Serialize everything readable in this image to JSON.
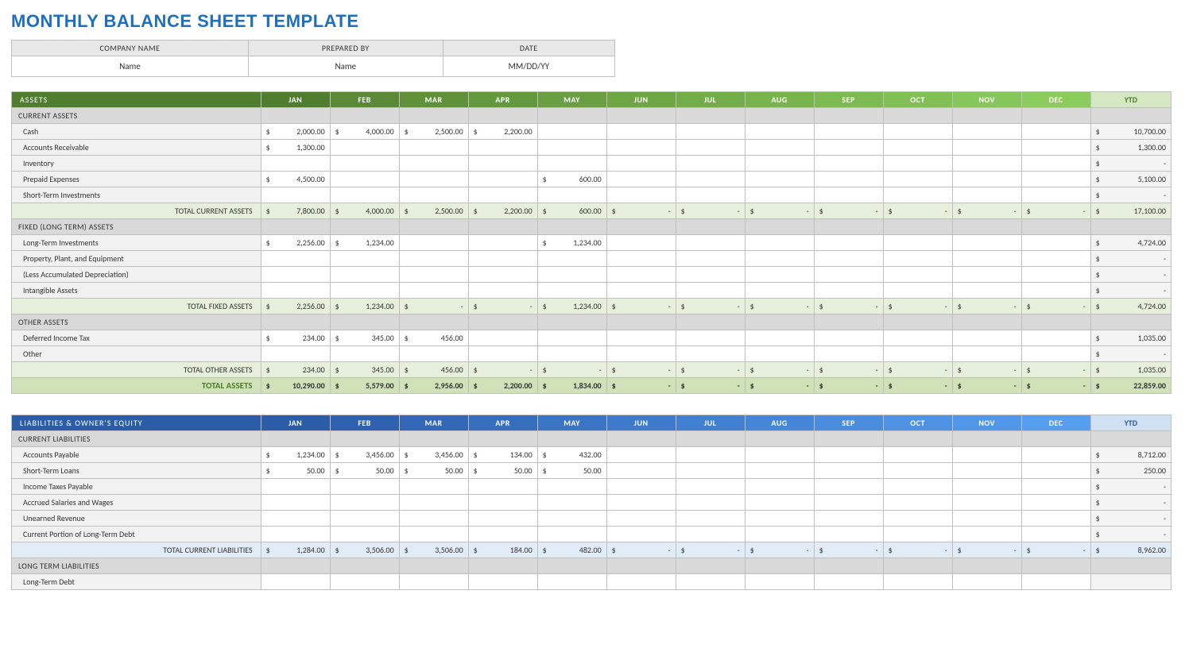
{
  "title": "MONTHLY BALANCE SHEET TEMPLATE",
  "info_headers": [
    "COMPANY NAME",
    "PREPARED BY",
    "DATE"
  ],
  "info_values": [
    "Name",
    "Name",
    "MM/DD/YY"
  ],
  "months": [
    "JAN",
    "FEB",
    "MAR",
    "APR",
    "MAY",
    "JUN",
    "JUL",
    "AUG",
    "SEP",
    "OCT",
    "NOV",
    "DEC"
  ],
  "ytd_label": "YTD",
  "sections": [
    {
      "id": "assets",
      "title": "ASSETS",
      "palette": "g",
      "groups": [
        {
          "header": "CURRENT ASSETS",
          "rows": [
            {
              "label": "Cash",
              "vals": [
                "2,000.00",
                "4,000.00",
                "2,500.00",
                "2,200.00",
                "",
                "",
                "",
                "",
                "",
                "",
                "",
                ""
              ],
              "ytd": "10,700.00"
            },
            {
              "label": "Accounts Receivable",
              "vals": [
                "1,300.00",
                "",
                "",
                "",
                "",
                "",
                "",
                "",
                "",
                "",
                "",
                ""
              ],
              "ytd": "1,300.00"
            },
            {
              "label": "Inventory",
              "vals": [
                "",
                "",
                "",
                "",
                "",
                "",
                "",
                "",
                "",
                "",
                "",
                ""
              ],
              "ytd": "-"
            },
            {
              "label": "Prepaid Expenses",
              "vals": [
                "4,500.00",
                "",
                "",
                "",
                "600.00",
                "",
                "",
                "",
                "",
                "",
                "",
                ""
              ],
              "ytd": "5,100.00"
            },
            {
              "label": "Short-Term Investments",
              "vals": [
                "",
                "",
                "",
                "",
                "",
                "",
                "",
                "",
                "",
                "",
                "",
                ""
              ],
              "ytd": "-"
            }
          ],
          "subtotal": {
            "label": "TOTAL CURRENT ASSETS",
            "vals": [
              "7,800.00",
              "4,000.00",
              "2,500.00",
              "2,200.00",
              "600.00",
              "-",
              "-",
              "-",
              "-",
              "-",
              "-",
              "-"
            ],
            "ytd": "17,100.00"
          }
        },
        {
          "header": "FIXED (LONG TERM) ASSETS",
          "rows": [
            {
              "label": "Long-Term Investments",
              "vals": [
                "2,256.00",
                "1,234.00",
                "",
                "",
                "1,234.00",
                "",
                "",
                "",
                "",
                "",
                "",
                ""
              ],
              "ytd": "4,724.00"
            },
            {
              "label": "Property, Plant, and Equipment",
              "vals": [
                "",
                "",
                "",
                "",
                "",
                "",
                "",
                "",
                "",
                "",
                "",
                ""
              ],
              "ytd": "-"
            },
            {
              "label": "(Less Accumulated Depreciation)",
              "vals": [
                "",
                "",
                "",
                "",
                "",
                "",
                "",
                "",
                "",
                "",
                "",
                ""
              ],
              "ytd": "-"
            },
            {
              "label": "Intangible Assets",
              "vals": [
                "",
                "",
                "",
                "",
                "",
                "",
                "",
                "",
                "",
                "",
                "",
                ""
              ],
              "ytd": "-"
            }
          ],
          "subtotal": {
            "label": "TOTAL FIXED ASSETS",
            "vals": [
              "2,256.00",
              "1,234.00",
              "-",
              "-",
              "1,234.00",
              "-",
              "-",
              "-",
              "-",
              "-",
              "-",
              "-"
            ],
            "ytd": "4,724.00"
          }
        },
        {
          "header": "OTHER ASSETS",
          "rows": [
            {
              "label": "Deferred Income Tax",
              "vals": [
                "234.00",
                "345.00",
                "456.00",
                "",
                "",
                "",
                "",
                "",
                "",
                "",
                "",
                ""
              ],
              "ytd": "1,035.00"
            },
            {
              "label": "Other",
              "vals": [
                "",
                "",
                "",
                "",
                "",
                "",
                "",
                "",
                "",
                "",
                "",
                ""
              ],
              "ytd": "-"
            }
          ],
          "subtotal": {
            "label": "TOTAL OTHER ASSETS",
            "vals": [
              "234.00",
              "345.00",
              "456.00",
              "-",
              "-",
              "-",
              "-",
              "-",
              "-",
              "-",
              "-",
              "-"
            ],
            "ytd": "1,035.00"
          }
        }
      ],
      "grand": {
        "label": "TOTAL ASSETS",
        "vals": [
          "10,290.00",
          "5,579.00",
          "2,956.00",
          "2,200.00",
          "1,834.00",
          "-",
          "-",
          "-",
          "-",
          "-",
          "-",
          "-"
        ],
        "ytd": "22,859.00"
      }
    },
    {
      "id": "liab",
      "title": "LIABILITIES & OWNER'S EQUITY",
      "palette": "b",
      "groups": [
        {
          "header": "CURRENT LIABILITIES",
          "rows": [
            {
              "label": "Accounts Payable",
              "vals": [
                "1,234.00",
                "3,456.00",
                "3,456.00",
                "134.00",
                "432.00",
                "",
                "",
                "",
                "",
                "",
                "",
                ""
              ],
              "ytd": "8,712.00"
            },
            {
              "label": "Short-Term Loans",
              "vals": [
                "50.00",
                "50.00",
                "50.00",
                "50.00",
                "50.00",
                "",
                "",
                "",
                "",
                "",
                "",
                ""
              ],
              "ytd": "250.00"
            },
            {
              "label": "Income Taxes Payable",
              "vals": [
                "",
                "",
                "",
                "",
                "",
                "",
                "",
                "",
                "",
                "",
                "",
                ""
              ],
              "ytd": "-"
            },
            {
              "label": "Accrued Salaries and Wages",
              "vals": [
                "",
                "",
                "",
                "",
                "",
                "",
                "",
                "",
                "",
                "",
                "",
                ""
              ],
              "ytd": "-"
            },
            {
              "label": "Unearned Revenue",
              "vals": [
                "",
                "",
                "",
                "",
                "",
                "",
                "",
                "",
                "",
                "",
                "",
                ""
              ],
              "ytd": "-"
            },
            {
              "label": "Current Portion of Long-Term Debt",
              "vals": [
                "",
                "",
                "",
                "",
                "",
                "",
                "",
                "",
                "",
                "",
                "",
                ""
              ],
              "ytd": "-"
            }
          ],
          "subtotal": {
            "label": "TOTAL CURRENT LIABILITIES",
            "vals": [
              "1,284.00",
              "3,506.00",
              "3,506.00",
              "184.00",
              "482.00",
              "-",
              "-",
              "-",
              "-",
              "-",
              "-",
              "-"
            ],
            "ytd": "8,962.00"
          }
        },
        {
          "header": "LONG TERM LIABILITIES",
          "rows": [
            {
              "label": "Long-Term Debt",
              "vals": [
                "",
                "",
                "",
                "",
                "",
                "",
                "",
                "",
                "",
                "",
                "",
                ""
              ],
              "ytd": ""
            }
          ]
        }
      ]
    }
  ]
}
